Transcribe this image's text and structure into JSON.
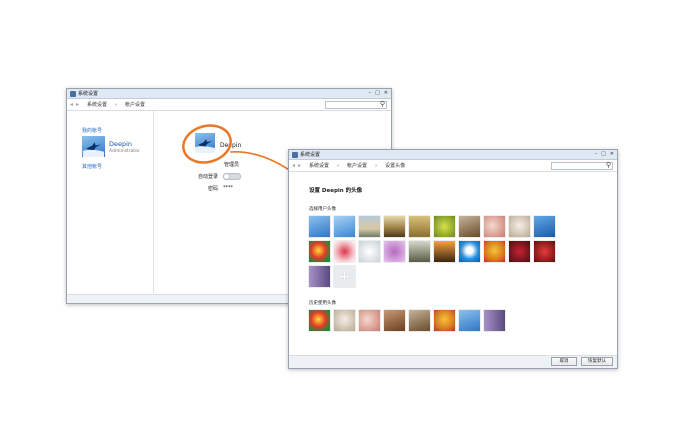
{
  "back_window": {
    "title": "系统设置",
    "breadcrumb": [
      "系统设置",
      "›",
      "帐户设置"
    ],
    "nav_back_icon": "arrow-left-icon",
    "nav_forward_icon": "arrow-right-icon",
    "search_icon": "search-icon",
    "sidebar": {
      "my_account_label": "我的帐号",
      "user_name": "Deepin",
      "user_role": "Administrator",
      "other_accounts_label": "其他帐号"
    },
    "main": {
      "user_name": "Deepin",
      "account_type_value": "管理员",
      "auto_login_label": "自动登录",
      "password_label": "密码",
      "password_value": "****"
    }
  },
  "front_window": {
    "title": "系统设置",
    "breadcrumb": [
      "系统设置",
      "›",
      "帐户设置",
      "›",
      "设置头像"
    ],
    "heading": "设置 Deepin 的头像",
    "section_select": "选择用户头像",
    "section_history": "历史使用头像",
    "add_icon": "plus-icon",
    "buttons": {
      "cancel": "取消",
      "restore": "恢复默认"
    }
  },
  "colors": {
    "accent": "#2a6bc2",
    "highlight_circle": "#e8782a",
    "titlebar": "#dfe9f3"
  },
  "avatars": {
    "row1": [
      "bird-blue",
      "bird-blue",
      "harbor",
      "ruins",
      "desert",
      "plant",
      "deer",
      "flower-pink",
      "cat",
      "bird-blue-2"
    ],
    "row2": [
      "parrot",
      "rose",
      "dandelion",
      "purple-flower",
      "grass",
      "eagle-sunset",
      "doraemon",
      "winnie",
      "red-flower",
      "red-berries"
    ],
    "row3": [
      "purple-cloth",
      "add"
    ],
    "history": [
      "parrot",
      "cat",
      "kitten",
      "dog",
      "deer",
      "winnie",
      "bird-blue",
      "purple-cloth"
    ]
  }
}
